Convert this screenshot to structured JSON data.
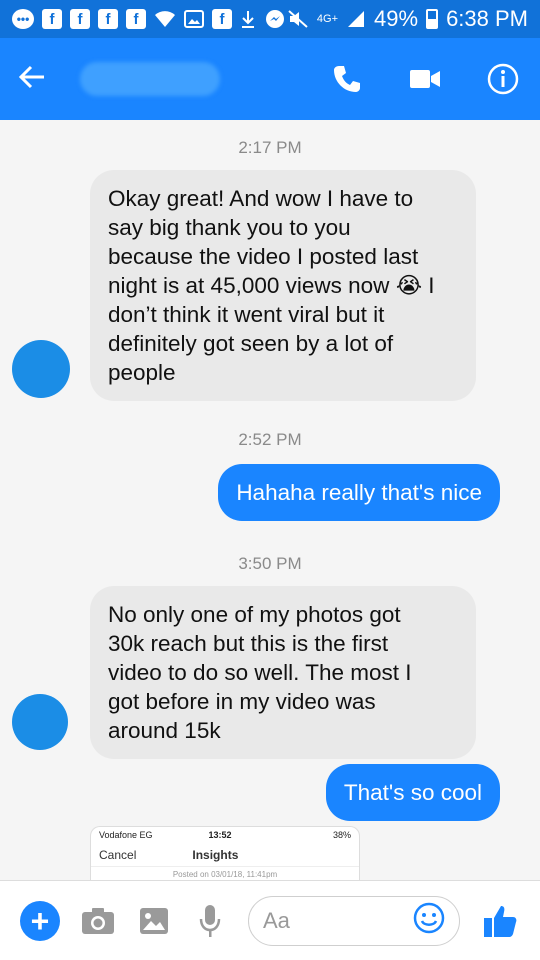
{
  "status_bar": {
    "network": "4G+",
    "battery": "49%",
    "battery_level": 0.49,
    "time": "6:38 PM"
  },
  "app_bar": {
    "icons": [
      "back-arrow-icon",
      "phone-icon",
      "video-icon",
      "info-icon"
    ]
  },
  "messages": [
    {
      "type": "timestamp",
      "text": "2:17 PM"
    },
    {
      "type": "received",
      "lines": [
        "Okay great! And wow I have to",
        "say big thank you to you",
        "because the video I posted last",
        "night is at 45,000 views now",
        "don’t think it went viral but it",
        "definitely got seen by a lot of",
        "people"
      ],
      "emoji_after_line_4": "😭",
      "line4_tail": "I"
    },
    {
      "type": "timestamp",
      "text": "2:52 PM"
    },
    {
      "type": "sent",
      "text": "Hahaha really that's nice"
    },
    {
      "type": "timestamp",
      "text": "3:50 PM"
    },
    {
      "type": "received",
      "lines": [
        "No only one of my photos got",
        "30k reach but this is the first",
        "video to do so well. The most I",
        "got before in my video was",
        "around 15k"
      ]
    },
    {
      "type": "sent",
      "text": "That's so cool"
    }
  ],
  "preview": {
    "carrier": "Vodafone EG",
    "time": "13:52",
    "battery": "38%",
    "cancel": "Cancel",
    "title": "Insights",
    "posted": "Posted on 03/01/18, 11:41pm"
  },
  "composer": {
    "placeholder": "Aa",
    "icons": [
      "plus-icon",
      "camera-icon",
      "image-icon",
      "microphone-icon",
      "emoji-icon",
      "thumbs-up-icon"
    ],
    "accent": "#1a85ff"
  },
  "colors": {
    "header": "#1a85ff",
    "status_bar": "#1172d9",
    "received_bubble": "#e9e9e9",
    "sent_bubble": "#1a85ff"
  }
}
